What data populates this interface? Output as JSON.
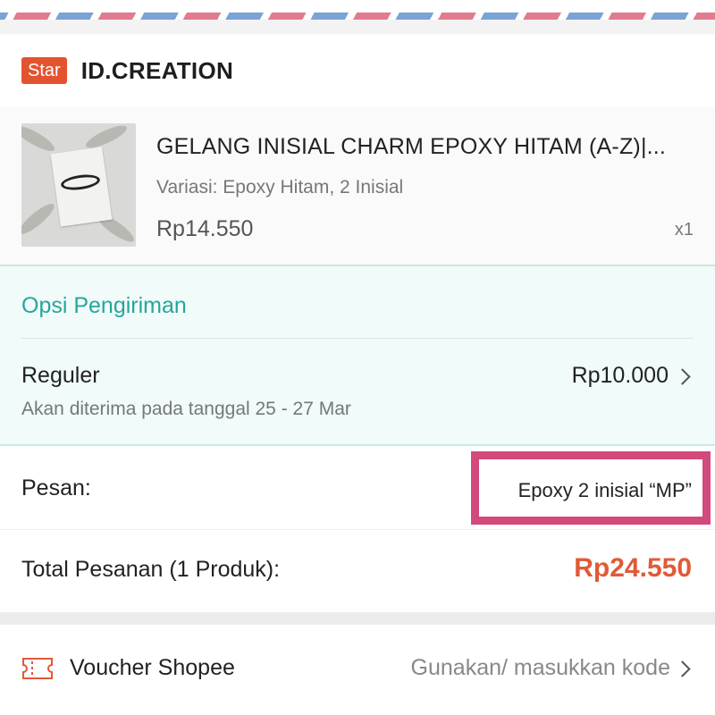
{
  "shop": {
    "badge": "Star",
    "name": "ID.CREATION"
  },
  "product": {
    "title": "GELANG INISIAL CHARM EPOXY HITAM (A-Z)|...",
    "variant": "Variasi: Epoxy Hitam, 2 Inisial",
    "price": "Rp14.550",
    "quantity": "x1",
    "thumbnail_icon": "product-thumbnail"
  },
  "shipping": {
    "heading": "Opsi Pengiriman",
    "method": "Reguler",
    "price": "Rp10.000",
    "eta": "Akan diterima pada tanggal 25 - 27 Mar"
  },
  "message": {
    "label": "Pesan:",
    "value": "Epoxy 2 inisial “MP”"
  },
  "order_total": {
    "label": "Total Pesanan (1 Produk):",
    "value": "Rp24.550"
  },
  "voucher": {
    "label": "Voucher Shopee",
    "hint": "Gunakan/ masukkan kode",
    "icon": "ticket-icon"
  },
  "colors": {
    "accent": "#e05a38",
    "badge": "#e4532f",
    "shipping_heading": "#26a69a",
    "shipping_bg": "#f0fbfa",
    "highlight_border": "#d2497c"
  }
}
